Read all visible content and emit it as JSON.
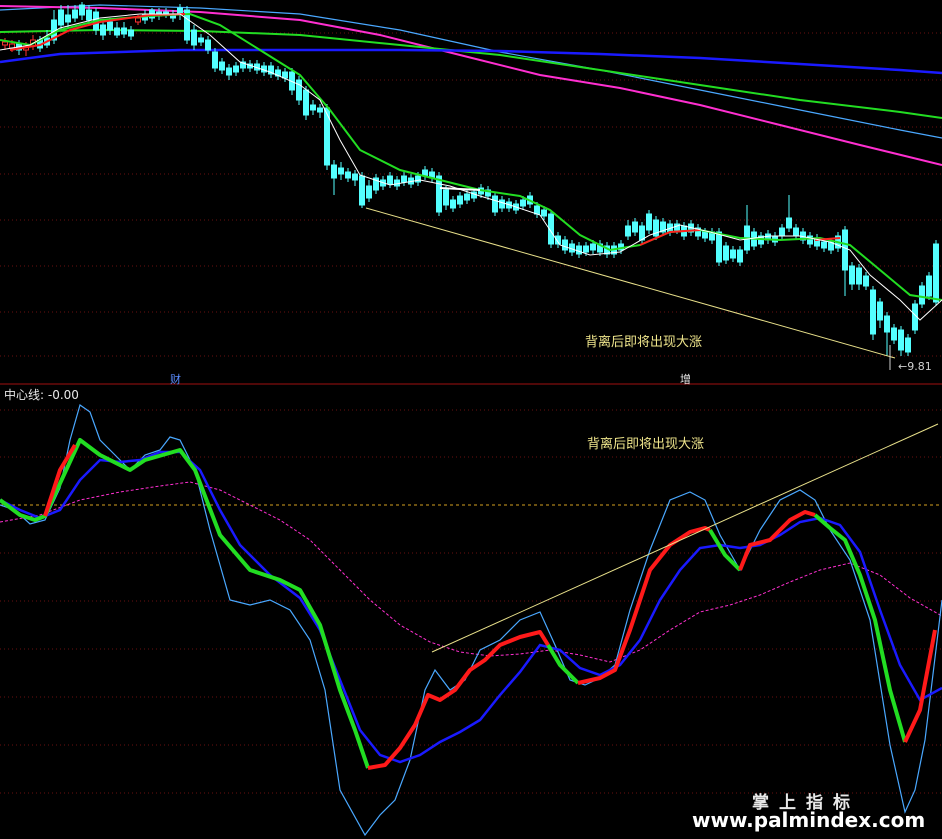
{
  "indicator": {
    "name_label": "中心线: -0.00"
  },
  "annotations": {
    "price_panel_note": "背离后即将出现大涨",
    "indicator_panel_note": "背离后即将出现大涨",
    "low_price_label": "←9.81",
    "event_marker_1": "财",
    "event_marker_2": "增"
  },
  "watermark": {
    "chinese": "掌上指标",
    "url": "www.palmindex.com"
  },
  "colors": {
    "background": "#000000",
    "up_candle": "#ff3232",
    "down_candle": "#54ffff",
    "ma_short": "#ffffff",
    "ma_trend_up": "#ff2020",
    "ma_trend_down": "#22dd22",
    "ma_long_blue": "#1a1aff",
    "ma_long_magenta": "#ff2fd0",
    "ma_long_cyan": "#4aa8ff",
    "divergence_line": "#e8e08a",
    "panel_divider": "#a01010",
    "grid_dotted": "#7a1010"
  }
}
